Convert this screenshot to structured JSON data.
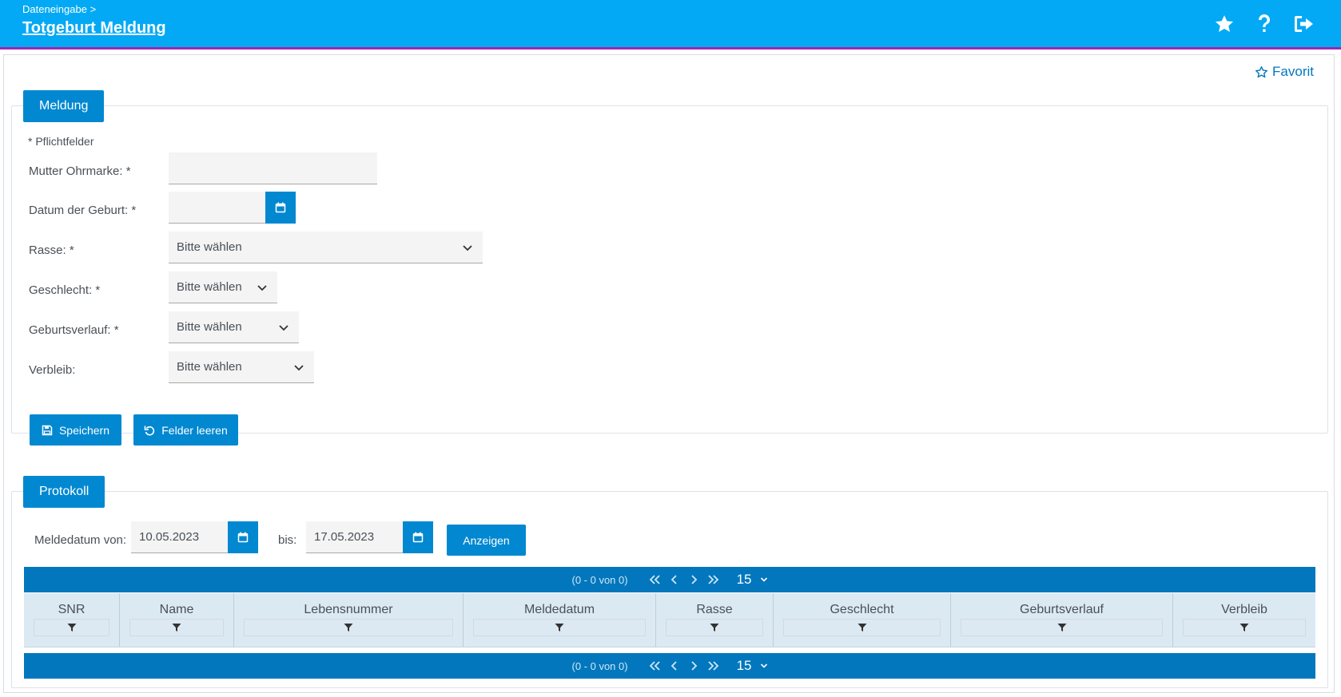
{
  "header": {
    "breadcrumb": "Dateneingabe >",
    "title": "Totgeburt Meldung",
    "icons": [
      "star-icon",
      "help-icon",
      "logout-icon"
    ]
  },
  "favorit": {
    "label": "Favorit"
  },
  "meldung": {
    "legend": "Meldung",
    "hint": "* Pflichtfelder",
    "fields": {
      "mutter_ohrmarke": {
        "label": "Mutter Ohrmarke: *",
        "value": ""
      },
      "datum_geburt": {
        "label": "Datum der Geburt: *",
        "value": ""
      },
      "rasse": {
        "label": "Rasse: *",
        "value": "Bitte wählen"
      },
      "geschlecht": {
        "label": "Geschlecht: *",
        "value": "Bitte wählen"
      },
      "geburtsverlauf": {
        "label": "Geburtsverlauf: *",
        "value": "Bitte wählen"
      },
      "verbleib": {
        "label": "Verbleib:",
        "value": "Bitte wählen"
      }
    },
    "buttons": {
      "save": "Speichern",
      "clear": "Felder leeren"
    }
  },
  "protokoll": {
    "legend": "Protokoll",
    "from_label": "Meldedatum von:",
    "from_value": "10.05.2023",
    "to_label": "bis:",
    "to_value": "17.05.2023",
    "show_button": "Anzeigen",
    "pager": {
      "report": "(0 - 0 von 0)",
      "rows_per_page": "15"
    },
    "columns": [
      "SNR",
      "Name",
      "Lebensnummer",
      "Meldedatum",
      "Rasse",
      "Geschlecht",
      "Geburtsverlauf",
      "Verbleib"
    ]
  },
  "colors": {
    "header": "#03a9f4",
    "accent": "#0288d1",
    "pager": "#0277bd",
    "header_border": "#9c27b0",
    "table_head": "#dbe9f3"
  }
}
